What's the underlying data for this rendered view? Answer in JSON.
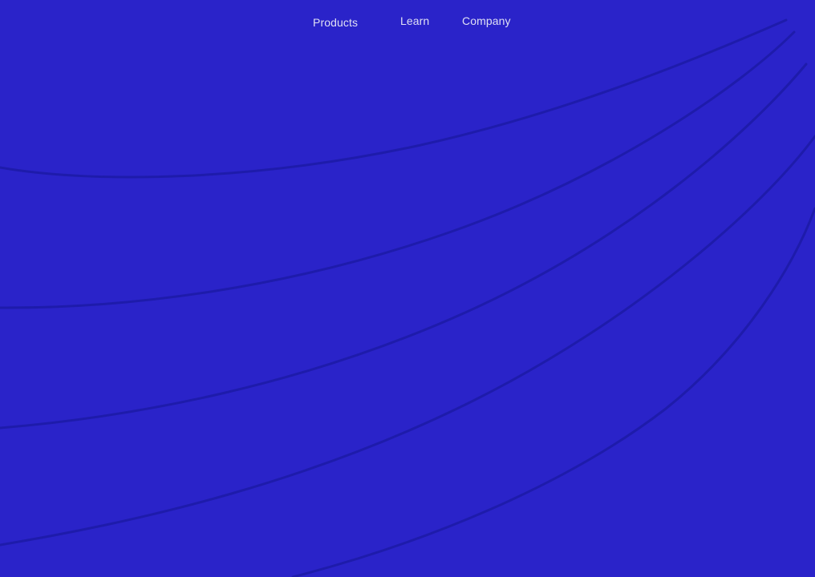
{
  "nav": {
    "items": [
      {
        "label": "Products"
      },
      {
        "label": "Learn"
      },
      {
        "label": "Company"
      }
    ]
  },
  "colors": {
    "background": "#2a23c9",
    "curve_stroke": "#1a1a9a",
    "nav_text": "#dfe0f4"
  }
}
